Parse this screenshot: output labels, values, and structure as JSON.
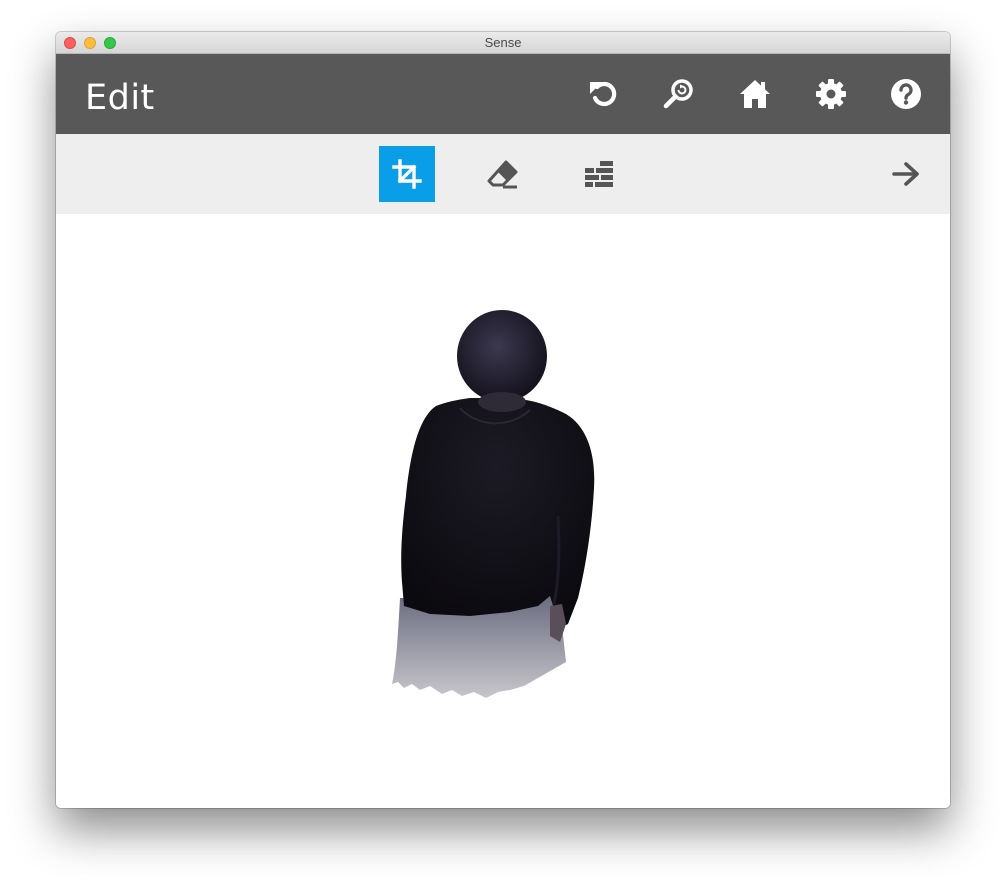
{
  "window": {
    "title": "Sense"
  },
  "header": {
    "title": "Edit",
    "actions": [
      {
        "name": "reset-button",
        "icon": "undo-icon"
      },
      {
        "name": "zoom-button",
        "icon": "zoom-reset-icon"
      },
      {
        "name": "home-button",
        "icon": "home-icon"
      },
      {
        "name": "settings-button",
        "icon": "gear-icon"
      },
      {
        "name": "help-button",
        "icon": "help-icon"
      }
    ]
  },
  "toolbar": {
    "tools": [
      {
        "name": "crop-tool",
        "icon": "crop-icon",
        "active": true
      },
      {
        "name": "erase-tool",
        "icon": "eraser-icon",
        "active": false
      },
      {
        "name": "solidify-tool",
        "icon": "bricks-icon",
        "active": false
      }
    ],
    "next": {
      "icon": "arrow-right-icon"
    }
  },
  "colors": {
    "header_bg": "#585858",
    "toolbar_bg": "#eeeeee",
    "active_tool": "#0a9ee8",
    "icon_light": "#ffffff",
    "icon_dark": "#555555"
  },
  "scan": {
    "subject": "3d-scan-person-back-view"
  }
}
